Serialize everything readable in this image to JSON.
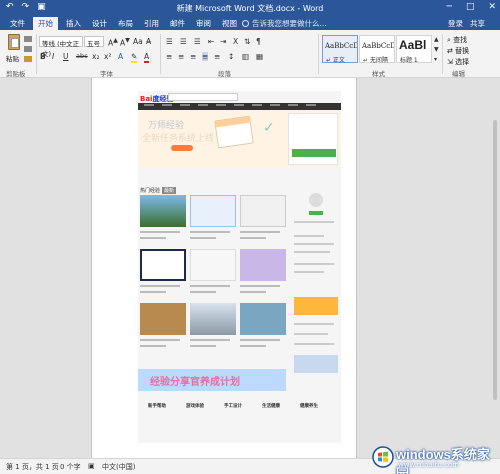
{
  "window": {
    "title": "新建 Microsoft Word 文档.docx - Word",
    "controls": [
      "─",
      "□",
      "✕"
    ]
  },
  "quick_access": {
    "undo": "↶",
    "redo": "↷",
    "save": "▣"
  },
  "tabs": [
    "文件",
    "开始",
    "插入",
    "设计",
    "布局",
    "引用",
    "邮件",
    "审阅",
    "视图"
  ],
  "active_tab": "开始",
  "tell_me": "告诉我您想要做什么...",
  "account": {
    "login": "登录",
    "share": "共享"
  },
  "ribbon": {
    "clipboard": {
      "paste": "粘贴",
      "label": "剪贴板"
    },
    "font": {
      "name": "等线 (中文正文)",
      "size": "五号",
      "label": "字体",
      "buttons": [
        "B",
        "I",
        "U",
        "abc",
        "x₂",
        "x²",
        "A",
        "A"
      ]
    },
    "paragraph": {
      "label": "段落"
    },
    "styles": {
      "label": "样式",
      "items": [
        {
          "preview": "AaBbCcDc",
          "name": "↵ 正文"
        },
        {
          "preview": "AaBbCcDc",
          "name": "↵ 无间隔"
        },
        {
          "preview": "AaBl",
          "name": "标题 1"
        }
      ]
    },
    "editing": {
      "find": "查找",
      "replace": "替换",
      "select": "选择",
      "label": "编辑"
    }
  },
  "document": {
    "embedded_screenshot": {
      "logo_bai": "Bai",
      "logo_du": "度经验",
      "banner_title": "万师经验",
      "banner_subtitle": "全新任务系统上线",
      "section_title": "热门经验",
      "section_tag": "最新",
      "blue_banner_text": "经验分享官养成计划",
      "footer_columns": [
        "新手帮助",
        "游戏体验",
        "手工设计",
        "生活健康",
        "健康养生"
      ]
    }
  },
  "status": {
    "page": "第 1 页，共 1 页",
    "words": "0 个字",
    "language": "中文(中国)"
  },
  "watermark": {
    "main": "windows系统家园",
    "sub": "www.ruhaitu.com"
  }
}
